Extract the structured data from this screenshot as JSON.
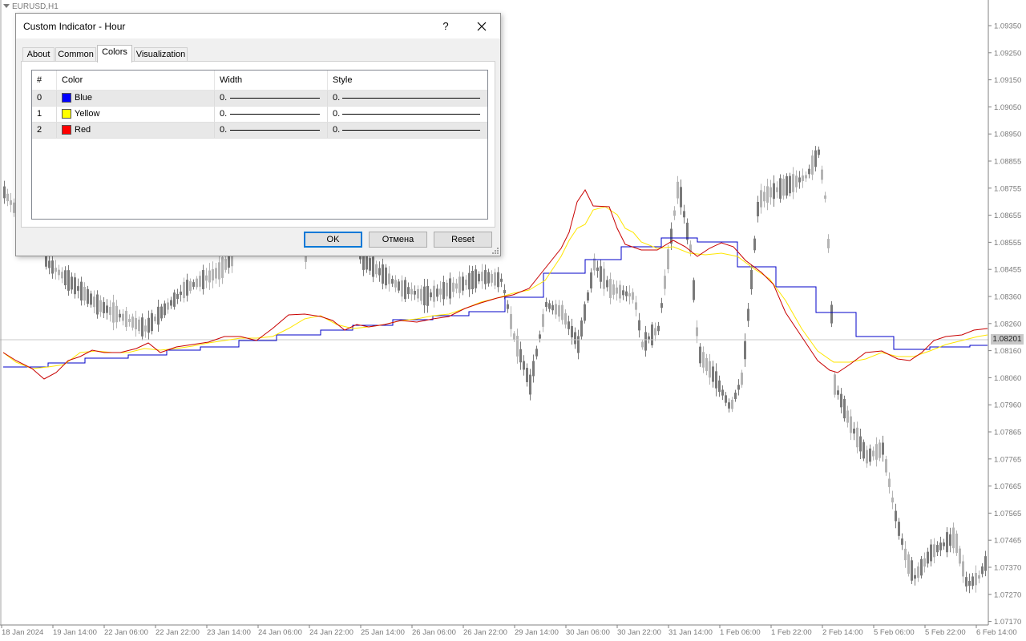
{
  "chart": {
    "symbol": "EURUSD,H1",
    "current_price": "1.08201",
    "price_levels": [
      "1.09350",
      "1.09250",
      "1.09150",
      "1.09050",
      "1.08950",
      "1.08855",
      "1.08755",
      "1.08655",
      "1.08555",
      "1.08455",
      "1.08360",
      "1.08260",
      "1.08160",
      "1.08060",
      "1.07960",
      "1.07865",
      "1.07765",
      "1.07665",
      "1.07565",
      "1.07465",
      "1.07370",
      "1.07270",
      "1.07170"
    ],
    "time_labels": [
      "18 Jan 2024",
      "19 Jan 14:00",
      "22 Jan 06:00",
      "22 Jan 22:00",
      "23 Jan 14:00",
      "24 Jan 06:00",
      "24 Jan 22:00",
      "25 Jan 14:00",
      "26 Jan 06:00",
      "26 Jan 22:00",
      "29 Jan 14:00",
      "30 Jan 06:00",
      "30 Jan 22:00",
      "31 Jan 14:00",
      "1 Feb 06:00",
      "1 Feb 22:00",
      "2 Feb 14:00",
      "5 Feb 06:00",
      "5 Feb 22:00",
      "6 Feb 14:00"
    ],
    "colors": {
      "blue_line": "#0000c8",
      "yellow_line": "#ffe600",
      "red_line": "#c80000",
      "candles": "#808080"
    }
  },
  "dialog": {
    "title": "Custom Indicator - Hour",
    "help_label": "?",
    "tabs": [
      "About",
      "Common",
      "Colors",
      "Visualization"
    ],
    "active_tab": "Colors",
    "columns": [
      "#",
      "Color",
      "Width",
      "Style"
    ],
    "rows": [
      {
        "index": "0",
        "color_name": "Blue",
        "swatch": "#0000ff",
        "width": "0.",
        "style": "0."
      },
      {
        "index": "1",
        "color_name": "Yellow",
        "swatch": "#ffff00",
        "width": "0.",
        "style": "0."
      },
      {
        "index": "2",
        "color_name": "Red",
        "swatch": "#ff0000",
        "width": "0.",
        "style": "0."
      }
    ],
    "buttons": {
      "ok": "OK",
      "cancel": "Отмена",
      "reset": "Reset"
    }
  }
}
